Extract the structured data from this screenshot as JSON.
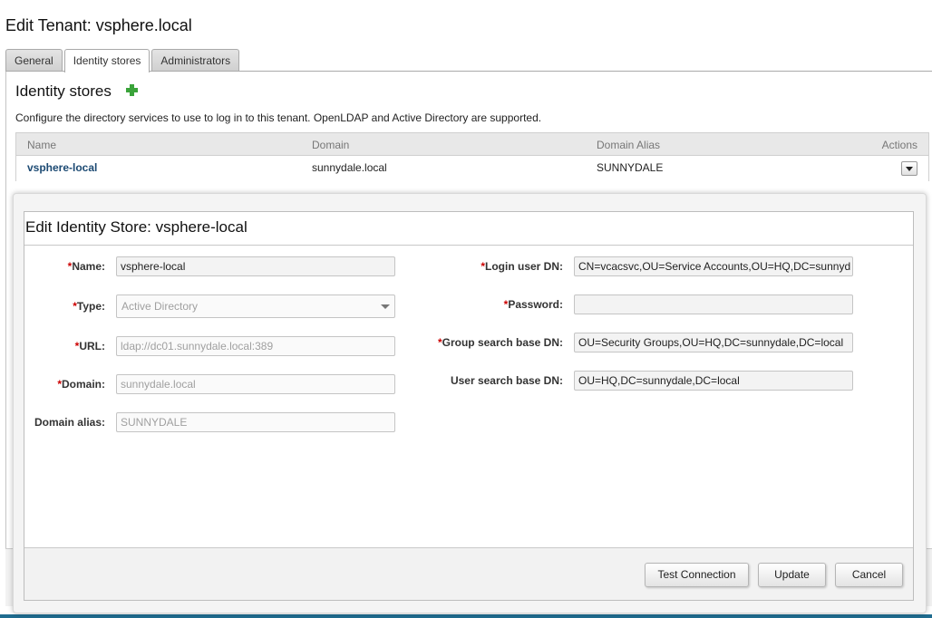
{
  "window": {
    "title": "Edit Tenant: vsphere.local"
  },
  "tabs": [
    {
      "label": "General",
      "active": false
    },
    {
      "label": "Identity stores",
      "active": true
    },
    {
      "label": "Administrators",
      "active": false
    }
  ],
  "identity_stores": {
    "title": "Identity stores",
    "description": "Configure the directory services to use to log in to this tenant. OpenLDAP and Active Directory are supported.",
    "add_icon": "plus-icon",
    "columns": [
      "Name",
      "Domain",
      "Domain Alias",
      "Actions"
    ],
    "rows": [
      {
        "name": "vsphere-local",
        "domain": "sunnydale.local",
        "alias": "SUNNYDALE"
      }
    ]
  },
  "dialog": {
    "title": "Edit Identity Store: vsphere-local",
    "left": {
      "name_label": "Name:",
      "name_value": "vsphere-local",
      "type_label": "Type:",
      "type_value": "Active Directory",
      "url_label": "URL:",
      "url_value": "ldap://dc01.sunnydale.local:389",
      "domain_label": "Domain:",
      "domain_value": "sunnydale.local",
      "alias_label": "Domain alias:",
      "alias_value": "SUNNYDALE"
    },
    "right": {
      "login_label": "Login user DN:",
      "login_value": "CN=vcacsvc,OU=Service Accounts,OU=HQ,DC=sunnyd",
      "password_label": "Password:",
      "password_value": "",
      "group_label": "Group search base DN:",
      "group_value": "OU=Security Groups,OU=HQ,DC=sunnydale,DC=local",
      "user_label": "User search base DN:",
      "user_value": "OU=HQ,DC=sunnydale,DC=local"
    },
    "required_marker": "*",
    "buttons": {
      "test": "Test Connection",
      "update": "Update",
      "cancel": "Cancel"
    }
  },
  "colors": {
    "link": "#1c4a73",
    "required": "#cc0000",
    "add": "#3aa33a",
    "bottom_bar": "#1f6c8f"
  }
}
